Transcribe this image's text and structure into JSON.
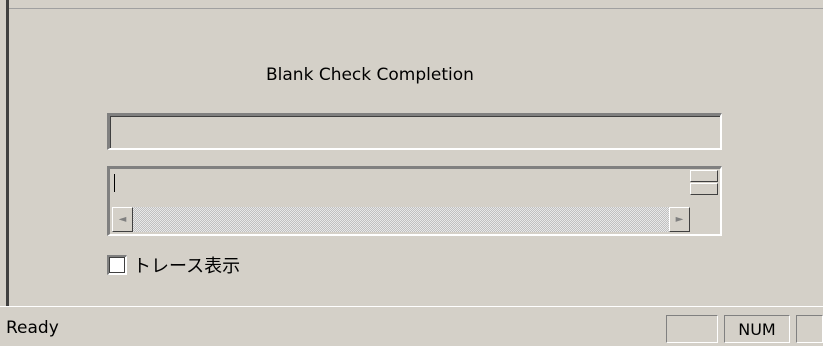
{
  "dialog": {
    "title_label": "Blank Check Completion",
    "progress_value": "",
    "log_text": ""
  },
  "options": {
    "trace_label": "トレース表示",
    "trace_checked": false
  },
  "scrollbar": {
    "left_arrow": "◄",
    "right_arrow": "►"
  },
  "status_bar": {
    "status_text": "Ready",
    "pane_1": "",
    "pane_2": "NUM",
    "pane_3": ""
  }
}
